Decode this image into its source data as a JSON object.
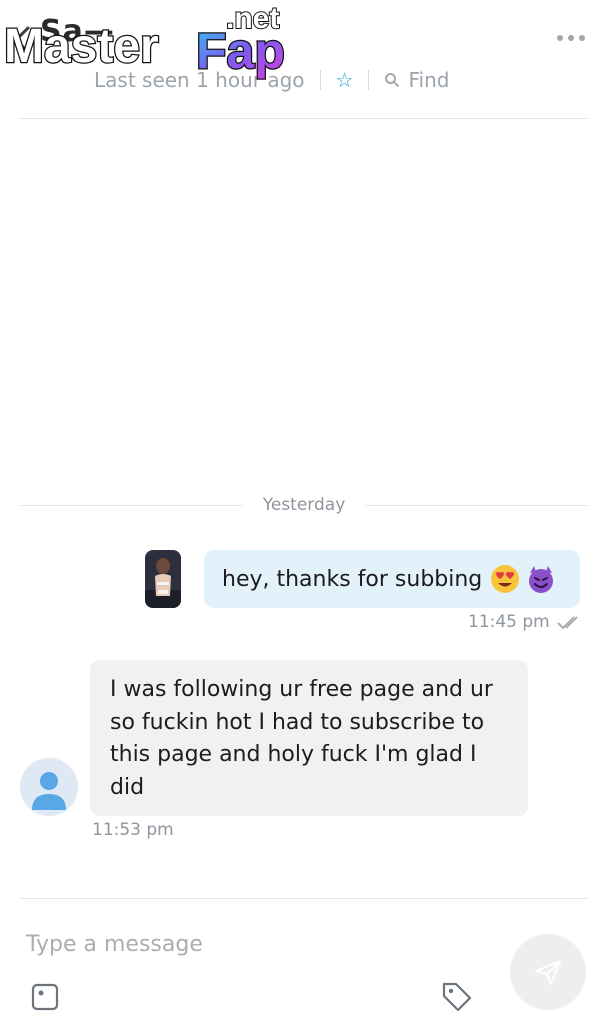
{
  "watermark": {
    "text_main": "Master",
    "text_accent": "Fap",
    "text_suffix": ".net"
  },
  "header": {
    "name": "Sa—",
    "last_seen": "Last seen 1 hour ago",
    "find_label": "Find",
    "more_icon": "more-horizontal-icon",
    "favorite_icon": "star-outline-icon",
    "accent_color": "#2f9ee0"
  },
  "chat": {
    "date_divider": "Yesterday",
    "messages": [
      {
        "direction": "outgoing",
        "text": "hey, thanks for subbing",
        "emojis": [
          "heart-eyes-emoji",
          "smiling-devil-emoji"
        ],
        "time": "11:45 pm",
        "status_icon": "double-check-icon"
      },
      {
        "direction": "incoming",
        "text": "I was following ur free page and ur so fuckin hot I had to subscribe to this page and holy fuck I'm glad I did",
        "time": "11:53 pm"
      }
    ]
  },
  "composer": {
    "placeholder": "Type a message",
    "send_icon": "send-icon",
    "image_icon": "image-icon",
    "price_icon": "price-tag-icon"
  }
}
